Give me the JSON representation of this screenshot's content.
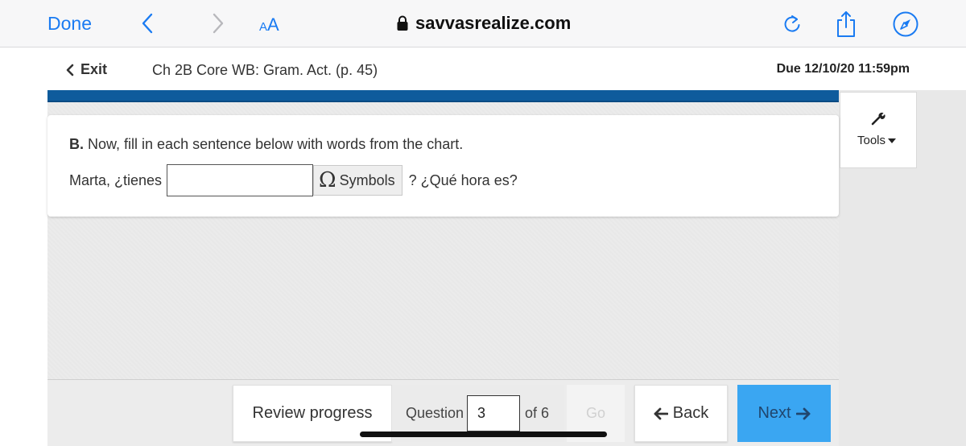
{
  "browser": {
    "done_label": "Done",
    "text_size_small": "A",
    "text_size_large": "A",
    "url": "savvasrealize.com",
    "accent_color": "#1a7bf2"
  },
  "header": {
    "exit_label": "Exit",
    "assignment_title": "Ch 2B Core WB: Gram. Act. (p. 45)",
    "due_text": "Due 12/10/20 11:59pm",
    "brand_color": "#0e5b9c"
  },
  "tools": {
    "label": "Tools"
  },
  "question": {
    "part_label": "B.",
    "instruction": "Now, fill in each sentence below with words from the chart.",
    "sentence_before": "Marta, ¿tienes",
    "answer_value": "",
    "symbols_label": "Symbols",
    "sentence_after": "? ¿Qué hora es?"
  },
  "footer": {
    "review_label": "Review progress",
    "question_label": "Question",
    "current_question": "3",
    "of_label": "of 6",
    "go_label": "Go",
    "back_label": "Back",
    "next_label": "Next",
    "next_color": "#3aa6f2"
  }
}
